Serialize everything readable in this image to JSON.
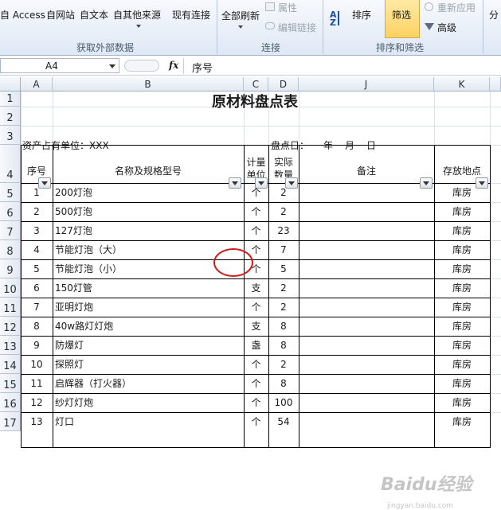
{
  "ribbon": {
    "access_label": "自 Access",
    "web_label": "自网站",
    "text_label": "自文本",
    "other_sources_label": "自其他来源",
    "existing_conn_label": "现有连接",
    "refresh_all_label": "全部刷新",
    "properties_label": "属性",
    "edit_links_label": "编辑链接",
    "sort_label": "排序",
    "filter_label": "筛选",
    "reapply_label": "重新应用",
    "advanced_label": "高级",
    "split_label": "分",
    "group_external": "获取外部数据",
    "group_connections": "连接",
    "group_sort_filter": "排序和筛选"
  },
  "formula_bar": {
    "name_box": "A4",
    "fx": "fx",
    "value": "序号"
  },
  "columns": [
    "A",
    "B",
    "C",
    "D",
    "J",
    "K"
  ],
  "rows": [
    "1",
    "2",
    "3",
    "4",
    "5",
    "6",
    "7",
    "8",
    "9",
    "10",
    "11",
    "12",
    "13",
    "14",
    "15",
    "16",
    "17"
  ],
  "sheet": {
    "title": "原材料盘点表",
    "owner_label": "资产占有单位：XXX",
    "date_label": "盘点日：",
    "year": "年",
    "month": "月",
    "day": "日",
    "headers": {
      "seq": "序号",
      "name": "名称及规格型号",
      "unit_l1": "计量",
      "unit_l2": "单位",
      "qty_l1": "实际",
      "qty_l2": "数量",
      "note": "备注",
      "location": "存放地点"
    },
    "items": [
      {
        "no": "1",
        "name": "200灯泡",
        "unit": "个",
        "qty": "2",
        "loc": "库房"
      },
      {
        "no": "2",
        "name": "500灯泡",
        "unit": "个",
        "qty": "2",
        "loc": "库房"
      },
      {
        "no": "3",
        "name": "127灯泡",
        "unit": "个",
        "qty": "23",
        "loc": "库房"
      },
      {
        "no": "4",
        "name": "节能灯泡（大）",
        "unit": "个",
        "qty": "7",
        "loc": "库房"
      },
      {
        "no": "5",
        "name": "节能灯泡（小）",
        "unit": "个",
        "qty": "5",
        "loc": "库房"
      },
      {
        "no": "6",
        "name": "150灯管",
        "unit": "支",
        "qty": "2",
        "loc": "库房"
      },
      {
        "no": "7",
        "name": "亚明灯炮",
        "unit": "个",
        "qty": "2",
        "loc": "库房"
      },
      {
        "no": "8",
        "name": "40w路灯灯炮",
        "unit": "支",
        "qty": "8",
        "loc": "库房"
      },
      {
        "no": "9",
        "name": "防爆灯",
        "unit": "盏",
        "qty": "8",
        "loc": "库房"
      },
      {
        "no": "10",
        "name": "探照灯",
        "unit": "个",
        "qty": "2",
        "loc": "库房"
      },
      {
        "no": "11",
        "name": "启辉器（打火器）",
        "unit": "个",
        "qty": "8",
        "loc": "库房"
      },
      {
        "no": "12",
        "name": "纱灯灯炮",
        "unit": "个",
        "qty": "100",
        "loc": "库房"
      },
      {
        "no": "13",
        "name": "灯口",
        "unit": "个",
        "qty": "54",
        "loc": "库房"
      }
    ]
  },
  "watermark": {
    "text": "Baidu经验",
    "sub": "jingyan.baidu.com"
  },
  "colors": {
    "accent_circle": "#d11a1a",
    "filter_active": "#fcd262",
    "header_bg": "#e3e9f1"
  }
}
